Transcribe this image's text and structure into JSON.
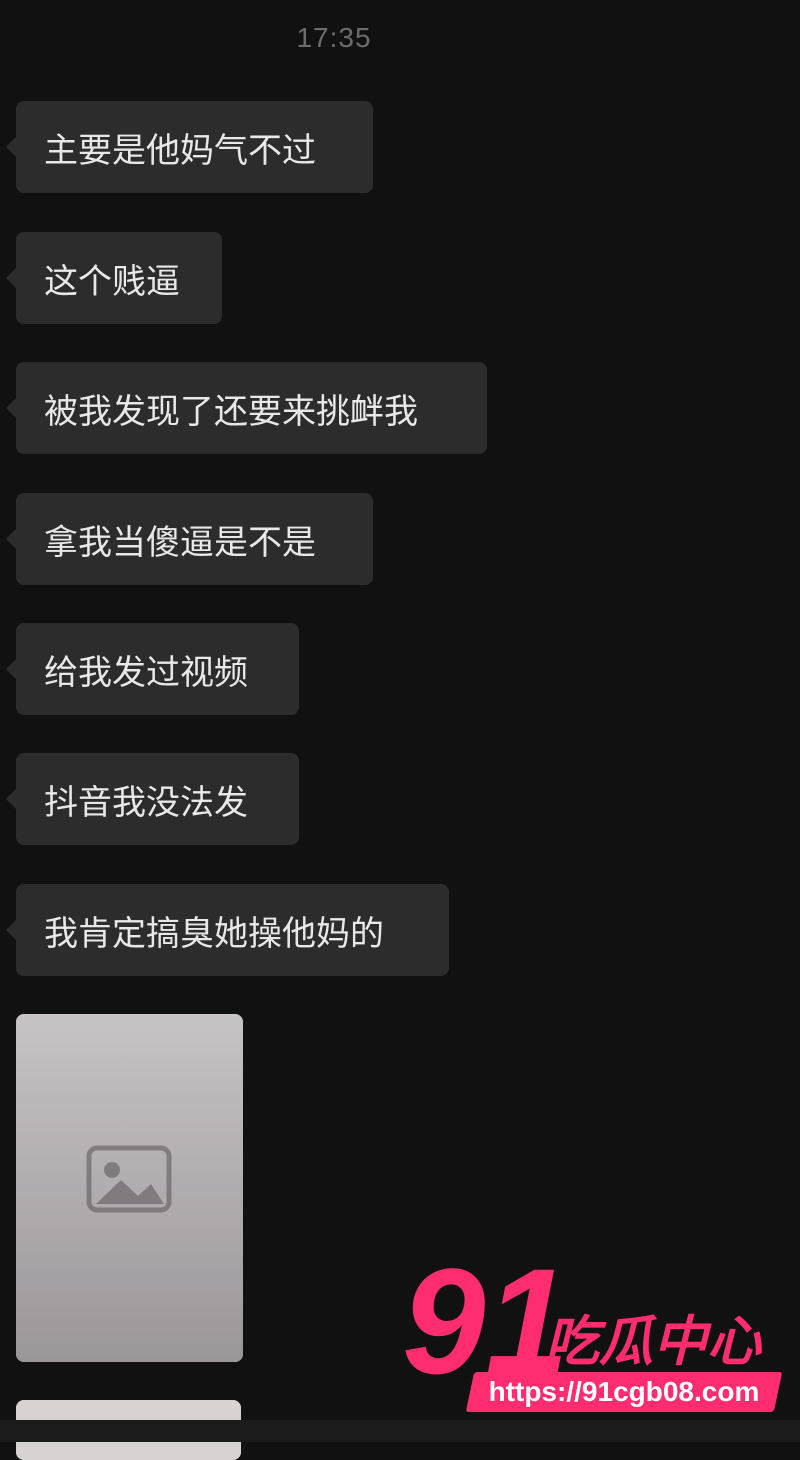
{
  "chat": {
    "timestamp": "17:35",
    "messages": [
      {
        "text": "主要是他妈气不过"
      },
      {
        "text": "这个贱逼"
      },
      {
        "text": "被我发现了还要来挑衅我"
      },
      {
        "text": "拿我当傻逼是不是"
      },
      {
        "text": "给我发过视频"
      },
      {
        "text": "抖音我没法发"
      },
      {
        "text": "我肯定搞臭她操他妈的"
      }
    ]
  },
  "watermark": {
    "number": "91",
    "brand": "吃瓜中心",
    "url": "https://91cgb08.com",
    "color": "#ff2d6f"
  },
  "colors": {
    "background": "#111111",
    "bubble": "#2c2c2c",
    "bubble_text": "#e8e8e8",
    "timestamp": "#6c6c6c"
  }
}
